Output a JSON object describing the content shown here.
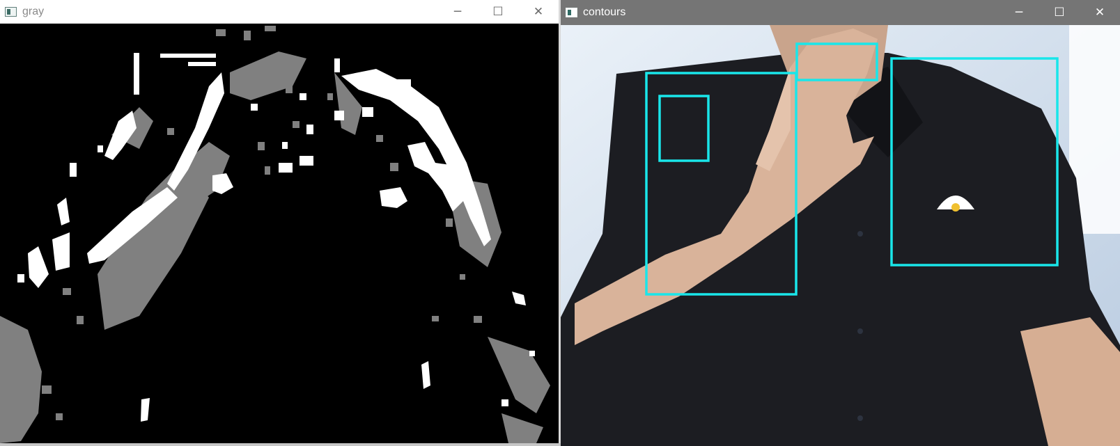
{
  "windows": {
    "gray": {
      "title": "gray",
      "icon": "opencv-window-icon",
      "controls": {
        "minimize": "─",
        "maximize": "☐",
        "close": "✕"
      }
    },
    "contours": {
      "title": "contours",
      "icon": "opencv-window-icon",
      "controls": {
        "minimize": "─",
        "maximize": "☐",
        "close": "✕"
      },
      "box_color": "#19e6ea"
    }
  },
  "colors": {
    "mask_white": "#ffffff",
    "mask_gray": "#808080",
    "mask_black": "#000000",
    "shirt": "#1c1d22",
    "skin": "#d9b39a",
    "wall": "#cfd9e6"
  }
}
